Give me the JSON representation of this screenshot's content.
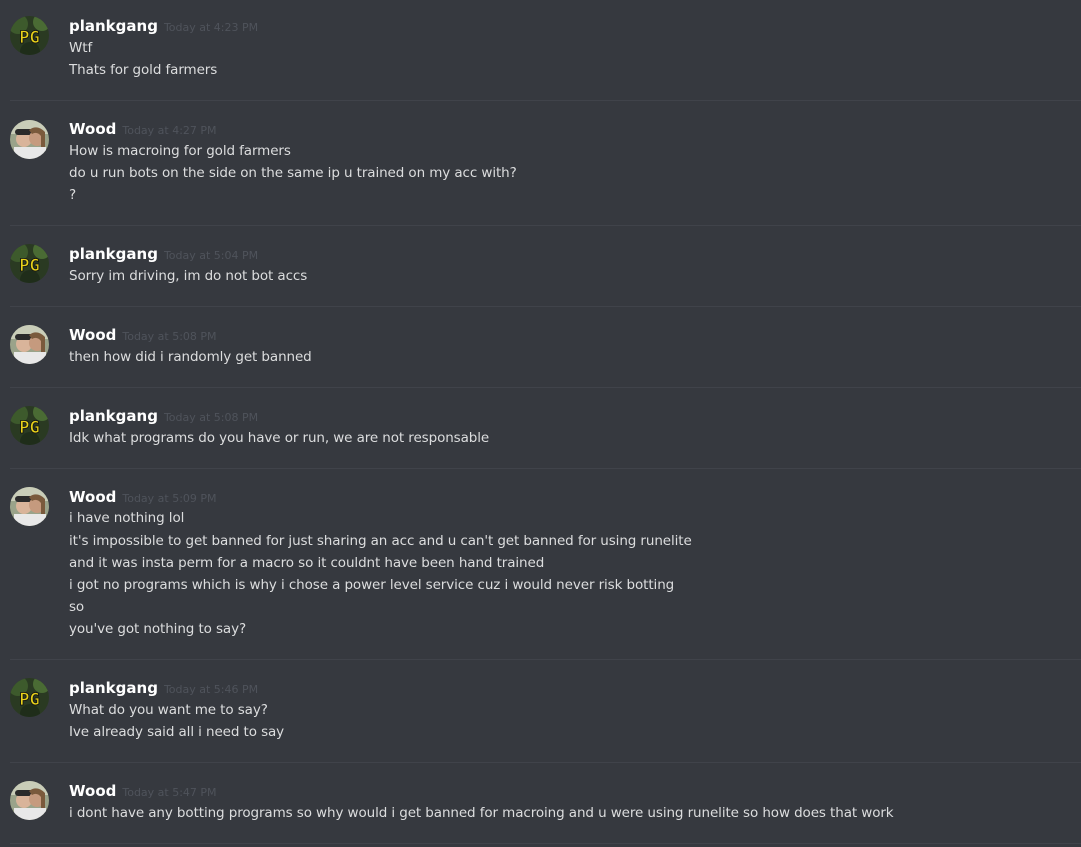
{
  "messages": [
    {
      "author": "plankgang",
      "timestamp": "Today at 4:23 PM",
      "avatar_icon": "plankgang-pg-avatar",
      "lines": [
        "Wtf",
        "Thats for gold farmers"
      ]
    },
    {
      "author": "Wood",
      "timestamp": "Today at 4:27 PM",
      "avatar_icon": "wood-photo-avatar",
      "lines": [
        "How is macroing for gold farmers",
        "do u run bots on the side on the same ip u trained on my acc with?",
        "?"
      ]
    },
    {
      "author": "plankgang",
      "timestamp": "Today at 5:04 PM",
      "avatar_icon": "plankgang-pg-avatar",
      "lines": [
        "Sorry im driving, im do not bot accs"
      ]
    },
    {
      "author": "Wood",
      "timestamp": "Today at 5:08 PM",
      "avatar_icon": "wood-photo-avatar",
      "lines": [
        "then how did i randomly get banned"
      ]
    },
    {
      "author": "plankgang",
      "timestamp": "Today at 5:08 PM",
      "avatar_icon": "plankgang-pg-avatar",
      "lines": [
        "Idk what programs do you have or run, we are not responsable"
      ]
    },
    {
      "author": "Wood",
      "timestamp": "Today at 5:09 PM",
      "avatar_icon": "wood-photo-avatar",
      "lines": [
        "i have nothing lol",
        "it's impossible to get banned for just sharing an acc and u can't get banned for using runelite",
        "and it was insta perm for a macro so it couldnt have been hand trained",
        "i got no programs which is why i chose a power level service cuz i would never risk botting",
        "so",
        "you've got nothing to say?"
      ]
    },
    {
      "author": "plankgang",
      "timestamp": "Today at 5:46 PM",
      "avatar_icon": "plankgang-pg-avatar",
      "lines": [
        "What do you want me to say?",
        "Ive already said all i need to say"
      ]
    },
    {
      "author": "Wood",
      "timestamp": "Today at 5:47 PM",
      "avatar_icon": "wood-photo-avatar",
      "lines": [
        "i dont have any botting programs so why would i get banned for macroing and u were using runelite so how does that work"
      ]
    }
  ],
  "avatar_text": "PG",
  "colors": {
    "background": "#36393f",
    "username": "#ffffff",
    "message_text": "#dcddde",
    "timestamp": "#4f535b",
    "divider": "#40434a",
    "pg_yellow": "#e8d21a"
  }
}
